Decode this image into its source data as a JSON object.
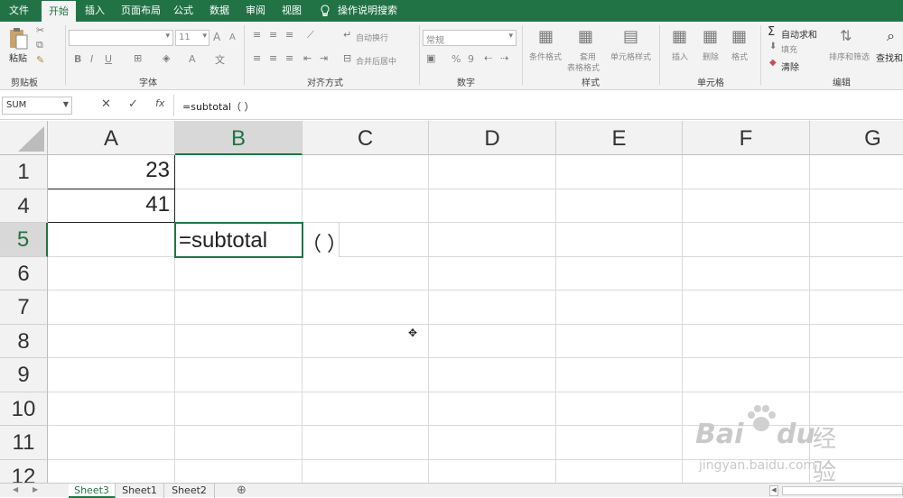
{
  "menu": [
    "文件",
    "开始",
    "插入",
    "页面布局",
    "公式",
    "数据",
    "审阅",
    "视图"
  ],
  "tell_me": "操作说明搜索",
  "ribbon": {
    "clipboard": {
      "paste": "粘贴",
      "label": "剪贴板"
    },
    "font": {
      "label": "字体",
      "size": "11",
      "bold": "B",
      "italic": "I",
      "underline": "U",
      "grow": "A",
      "shrink": "A",
      "color": "A"
    },
    "align": {
      "wrap": "自动换行",
      "merge": "合并后居中",
      "label": "对齐方式"
    },
    "number": {
      "format": "常规",
      "percent": "%",
      "comma": "9",
      "label": "数字"
    },
    "styles": {
      "cond": "条件格式",
      "table1": "套用",
      "table2": "表格格式",
      "cell": "单元格样式",
      "label": "样式"
    },
    "cells": {
      "insert": "插入",
      "delete": "删除",
      "format": "格式",
      "label": "单元格"
    },
    "editing": {
      "autosum": "自动求和",
      "fill": "填充",
      "clear": "清除",
      "sort": "排序和筛选",
      "find": "查找和",
      "label": "编辑"
    }
  },
  "formula_bar": {
    "name_box": "SUM",
    "cancel": "✕",
    "enter": "✓",
    "fx": "fx",
    "formula": "=subtotal（ ）"
  },
  "columns": [
    "A",
    "B",
    "C",
    "D",
    "E",
    "F",
    "G"
  ],
  "rows": [
    "1",
    "4",
    "5",
    "6",
    "7",
    "8",
    "9",
    "10",
    "11",
    "12"
  ],
  "cells": {
    "A1": "23",
    "A4": "41",
    "B5_editing": "=subtotal",
    "B5_paren": "（ ）"
  },
  "tabs": [
    "Sheet3",
    "Sheet1",
    "Sheet2"
  ],
  "add_sheet": "⊕",
  "nav": {
    "prev": "◀",
    "next": "▶"
  },
  "watermark": {
    "brand": "Bai",
    "brand2": "du",
    "brand_cn": "经验",
    "url": "jingyan.baidu.com"
  },
  "colors": {
    "excel_green": "#217346",
    "header_gray": "#f2f2f2",
    "selected_header": "#d8d8d8"
  }
}
